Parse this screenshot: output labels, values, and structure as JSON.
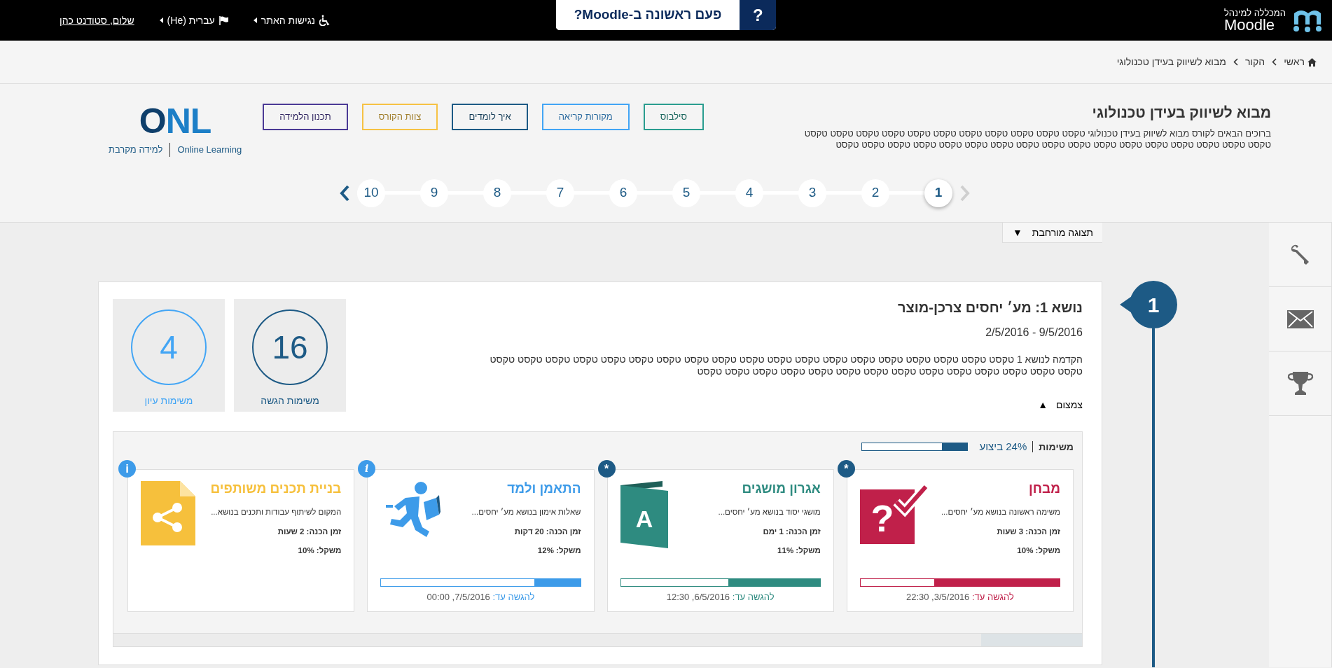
{
  "top_bar": {
    "logo": {
      "subtitle": "המכללה למינהל",
      "title": "Moodle"
    },
    "help_button": {
      "icon": "?",
      "label": "פעם ראשונה ב-Moodle?"
    },
    "links": [
      {
        "kind": "accessibility",
        "label": "נגישות האתר"
      },
      {
        "kind": "language",
        "label": "עברית (He)"
      }
    ],
    "user": "שלום, סטודנט כהן"
  },
  "breadcrumb": [
    {
      "kind": "home",
      "label": "ראשי"
    },
    {
      "kind": "page",
      "label": "הקור"
    },
    {
      "kind": "page",
      "label": "מבוא לשיווק בעידן טכנולוגי"
    }
  ],
  "course": {
    "title": "מבוא לשיווק בעידן טכנולוגי",
    "description": "ברוכים הבאים לקורס מבוא לשיווק בעידן טכנולוגי טקסט טקסט טקסט טקסט טקסט טקסט טקסט טקסט טקסט טקסט טקסט טקסט טקסט טקסט טקסט טקסט טקסט טקסט טקסט טקסט טקסט טקסט טקסט טקסט טקסט טקסט טקסט טקסט",
    "links": [
      {
        "label": "סילבוס",
        "color": "#2a9d8f"
      },
      {
        "label": "מקורות קריאה",
        "color": "#42a5f5"
      },
      {
        "label": "איך לומדים",
        "color": "#1d5a85"
      },
      {
        "label": "צוות הקורס",
        "color": "#f6c244"
      },
      {
        "label": "תכנון הלמידה",
        "color": "#4b3a95"
      }
    ],
    "brand": {
      "logo": "ONL",
      "name": "Online Learning",
      "tagline": "למידה מקרבת"
    }
  },
  "topics_nav": {
    "prev_disabled": true,
    "next_disabled": false,
    "steps": [
      {
        "label": "1",
        "selected": true
      },
      {
        "label": "2",
        "selected": false
      },
      {
        "label": "3",
        "selected": false
      },
      {
        "label": "4",
        "selected": false
      },
      {
        "label": "5",
        "selected": false
      },
      {
        "label": "6",
        "selected": false
      },
      {
        "label": "7",
        "selected": false
      },
      {
        "label": "8",
        "selected": false
      },
      {
        "label": "9",
        "selected": false
      },
      {
        "label": "10",
        "selected": false
      }
    ]
  },
  "view_toggle": {
    "label": "תצוגה מורחבת",
    "icon": "▼"
  },
  "sidebar_buttons": [
    {
      "kind": "settings"
    },
    {
      "kind": "messages"
    },
    {
      "kind": "achievements"
    }
  ],
  "topic": {
    "number": "1",
    "title": "נושא 1: מע׳ יחסים צרכן-מוצר",
    "dates": "2/5/2016 - 9/5/2016",
    "intro": "הקדמה לנושא 1 טקסט טקסט טקסט טקסט טקסט טקסט טקסט טקסט טקסט טקסט טקסט טקסט טקסט טקסט טקסט טקסט טקסט טקסט טקסט טקסט טקסט טקסט טקסט טקסט טקסט טקסט טקסט טקסט טקסט טקסט טקסט טקסט טקסט",
    "stats": [
      {
        "count": "16",
        "label": "משימות הגשה",
        "color": "#1d5a85"
      },
      {
        "count": "4",
        "label": "משימות עיון",
        "color": "#42a5f5"
      }
    ],
    "collapse": {
      "label": "צמצום",
      "icon": "▲"
    },
    "tasks_header": {
      "label": "משימות",
      "progress_label": "24% ביצוע",
      "level": 0.24
    },
    "tasks": [
      {
        "kind": "quiz",
        "title": "מבחן",
        "color": "#c0204a",
        "badge": {
          "label": "*",
          "color": "#1d5a85"
        },
        "icon_text": "?",
        "description": "משימה ראשונה בנושא מע׳ יחסים...",
        "prep": "זמן הכנה: 3 שעות",
        "weight": "משקל: 10%",
        "level": 0.63,
        "due_label": "להגשה עד:",
        "due": "3/5/2016, 22:30"
      },
      {
        "kind": "glossary",
        "title": "אגרון מושגים",
        "color": "#2e8b80",
        "badge": {
          "label": "*",
          "color": "#1d5a85"
        },
        "icon_text": "A",
        "description": "מושגי יסוד בנושא מע׳ יחסים...",
        "prep": "זמן הכנה: 1 ימם",
        "weight": "משקל: 11%",
        "level": 0.46,
        "due_label": "להגשה עד:",
        "due": "6/5/2016, 12:30"
      },
      {
        "kind": "practice",
        "title": "התאמן ולמד",
        "color": "#3d9be9",
        "badge": {
          "label": "i",
          "color": "#3d9be9"
        },
        "description": "שאלות אימון בנושא מע׳ יחסים...",
        "prep": "זמן הכנה: 20 דקות",
        "weight": "משקל: 12%",
        "level": 0.23,
        "due_label": "להגשה עד:",
        "due": "7/5/2016, 00:00"
      },
      {
        "kind": "share",
        "title": "בניית תכנים משותפים",
        "color": "#f6c03c",
        "badge": {
          "label": "i",
          "color": "#3d9be9"
        },
        "description": "המקום לשיתוף עבודות ותכנים בנושא...",
        "prep": "זמן הכנה: 2 שעות",
        "weight": "משקל: 10%"
      }
    ]
  }
}
